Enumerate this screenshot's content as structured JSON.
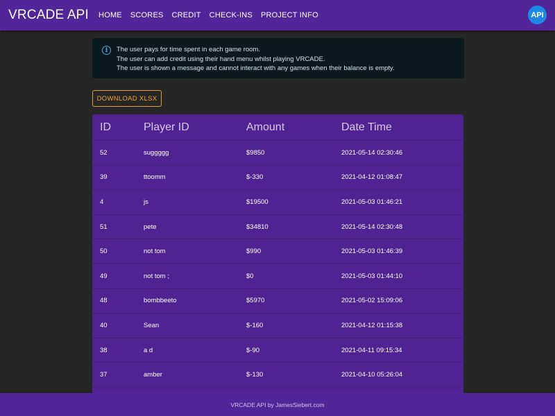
{
  "header": {
    "brand": "VRCADE API",
    "nav": [
      "HOME",
      "SCORES",
      "CREDIT",
      "CHECK-INS",
      "PROJECT INFO"
    ],
    "avatar_label": "API"
  },
  "alert": {
    "icon": "info-icon",
    "lines": [
      "The user pays for time spent in each game room.",
      "The user can add credit using their hand menu whilst playing VRCADE.",
      "The user is shown a message and cannot interact with any games when their balance is empty."
    ]
  },
  "download_label": "DOWNLOAD XLSX",
  "table": {
    "headers": [
      "ID",
      "Player ID",
      "Amount",
      "Date Time"
    ],
    "rows": [
      [
        "52",
        "suggggg",
        "$9850",
        "2021-05-14 02:30:46"
      ],
      [
        "39",
        "ttoomm",
        "$-330",
        "2021-04-12 01:08:47"
      ],
      [
        "4",
        "js",
        "$19500",
        "2021-05-03 01:46:21"
      ],
      [
        "51",
        "pete",
        "$34810",
        "2021-05-14 02:30:48"
      ],
      [
        "50",
        "not tom",
        "$990",
        "2021-05-03 01:46:39"
      ],
      [
        "49",
        "not tom ;",
        "$0",
        "2021-05-03 01:44:10"
      ],
      [
        "48",
        "bombbeeto",
        "$5970",
        "2021-05-02 15:09:06"
      ],
      [
        "40",
        "Sean",
        "$-160",
        "2021-04-12 01:15:38"
      ],
      [
        "38",
        "a d",
        "$-90",
        "2021-04-11 09:15:34"
      ],
      [
        "37",
        "amber",
        "$-130",
        "2021-04-10 05:26:04"
      ]
    ]
  },
  "footer": "VRCADE API by JamesSiebert.com",
  "colors": {
    "header_bg": "#522698",
    "page_bg": "#262626",
    "table_bg": "#512291",
    "accent_orange": "#f0a53a",
    "info_blue": "#4fa8dc"
  }
}
